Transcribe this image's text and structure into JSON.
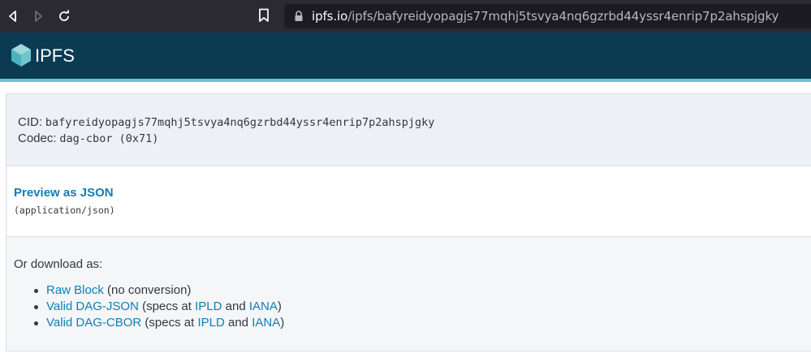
{
  "browser": {
    "url_host": "ipfs.io",
    "url_path": "/ipfs/bafyreidyopagjs77mqhj5tsvya4nq6gzrbd44yssr4enrip7p2ahspjgky",
    "icons": [
      "back-icon",
      "forward-icon",
      "reload-icon",
      "bookmark-icon",
      "lock-icon"
    ]
  },
  "header": {
    "brand": "IPFS",
    "logo_icon": "ipfs-cube-icon",
    "colors": {
      "background": "#0b3a53",
      "stripe": "#69c4cd"
    }
  },
  "cid_panel": {
    "cid_label": "CID:",
    "cid_value": "bafyreidyopagjs77mqhj5tsvya4nq6gzrbd44yssr4enrip7p2ahspjgky",
    "codec_label": "Codec:",
    "codec_value": "dag-cbor (0x71)"
  },
  "preview_panel": {
    "link_label": "Preview as JSON",
    "mime": "(application/json)"
  },
  "download_panel": {
    "title": "Or download as:",
    "items": [
      {
        "link": "Raw Block",
        "text1": " (no conversion)"
      },
      {
        "link": "Valid DAG-JSON",
        "text1": " (specs at ",
        "link2": "IPLD",
        "text2": " and ",
        "link3": "IANA",
        "text3": ")"
      },
      {
        "link": "Valid DAG-CBOR",
        "text1": " (specs at ",
        "link2": "IPLD",
        "text2": " and ",
        "link3": "IANA",
        "text3": ")"
      }
    ],
    "link_color": "#117eb3"
  }
}
